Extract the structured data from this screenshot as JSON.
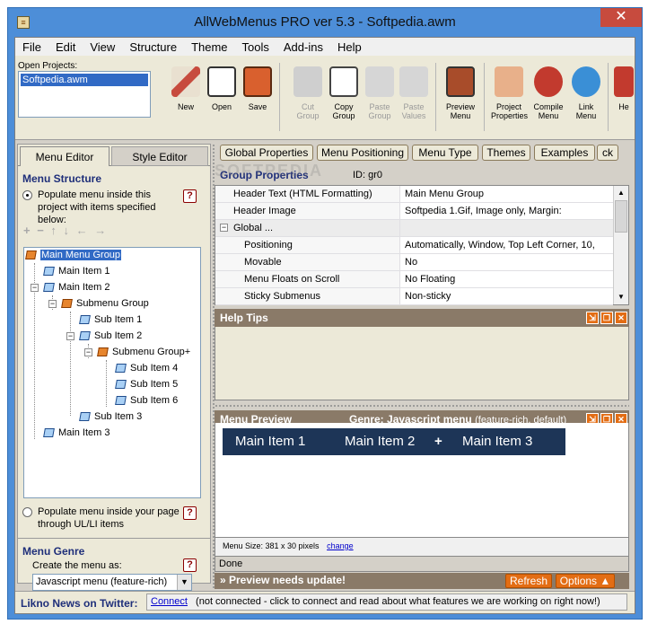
{
  "window": {
    "title": "AllWebMenus PRO ver 5.3 - Softpedia.awm",
    "close_glyph": "✕"
  },
  "menubar": [
    "File",
    "Edit",
    "View",
    "Structure",
    "Theme",
    "Tools",
    "Add-ins",
    "Help"
  ],
  "toolbar": {
    "open_projects_label": "Open Projects:",
    "open_projects": [
      "Softpedia.awm"
    ],
    "buttons": [
      {
        "label": "New",
        "icon": "new-icon",
        "enabled": true
      },
      {
        "label": "Open",
        "icon": "open-icon",
        "enabled": true
      },
      {
        "label": "Save",
        "icon": "save-icon",
        "enabled": true
      },
      {
        "label": "Cut Group",
        "icon": "cut-icon",
        "enabled": false
      },
      {
        "label": "Copy Group",
        "icon": "copy-icon",
        "enabled": true
      },
      {
        "label": "Paste Group",
        "icon": "paste-group-icon",
        "enabled": false
      },
      {
        "label": "Paste Values",
        "icon": "paste-values-icon",
        "enabled": false
      },
      {
        "label": "Preview Menu",
        "icon": "preview-icon",
        "enabled": true
      },
      {
        "label": "Project Properties",
        "icon": "properties-icon",
        "enabled": true
      },
      {
        "label": "Compile Menu",
        "icon": "compile-icon",
        "enabled": true
      },
      {
        "label": "Link Menu",
        "icon": "link-icon",
        "enabled": true
      },
      {
        "label": "He",
        "icon": "help-icon",
        "enabled": true
      }
    ]
  },
  "left_panel": {
    "tabs": [
      "Menu Editor",
      "Style Editor"
    ],
    "menu_structure_title": "Menu Structure",
    "populate_option_1": "Populate menu inside this project with items specified below:",
    "populate_option_2": "Populate menu inside your page through UL/LI items",
    "help_glyph": "?",
    "edit_toolbar_glyphs": "+ −   ↑ ↓ ← →",
    "tree": [
      {
        "label": "Main Menu Group",
        "level": 0,
        "group": true,
        "selected": true
      },
      {
        "label": "Main Item 1",
        "level": 1,
        "group": false
      },
      {
        "label": "Main Item 2",
        "level": 1,
        "group": false,
        "expander": "−"
      },
      {
        "label": "Submenu Group",
        "level": 2,
        "group": true,
        "expander": "−"
      },
      {
        "label": "Sub Item 1",
        "level": 3,
        "group": false
      },
      {
        "label": "Sub Item 2",
        "level": 3,
        "group": false,
        "expander": "−"
      },
      {
        "label": "Submenu Group+",
        "level": 4,
        "group": true,
        "expander": "−"
      },
      {
        "label": "Sub Item 4",
        "level": 5,
        "group": false
      },
      {
        "label": "Sub Item 5",
        "level": 5,
        "group": false
      },
      {
        "label": "Sub Item 6",
        "level": 5,
        "group": false
      },
      {
        "label": "Sub Item 3",
        "level": 3,
        "group": false
      },
      {
        "label": "Main Item 3",
        "level": 1,
        "group": false
      }
    ],
    "menu_genre_title": "Menu Genre",
    "create_label": "Create the menu as:",
    "genre_value": "Javascript menu (feature-rich)",
    "dropdown_glyph": "▼"
  },
  "right_panel": {
    "buttons": [
      "Global Properties",
      "Menu Positioning",
      "Menu Type",
      "Themes",
      "Examples",
      "ck"
    ],
    "group_properties_label": "Group Properties",
    "group_id": "ID: gr0",
    "properties": [
      {
        "name": "Header Text (HTML Formatting)",
        "value": "Main Menu Group",
        "indent": 1
      },
      {
        "name": "Header Image",
        "value": "Softpedia 1.Gif, Image only, Margin:",
        "indent": 1
      },
      {
        "name": "Global ...",
        "value": "",
        "indent": 0,
        "expander": "−"
      },
      {
        "name": "Positioning",
        "value": "Automatically, Window, Top Left Corner, 10,",
        "indent": 2
      },
      {
        "name": "Movable",
        "value": "No",
        "indent": 2
      },
      {
        "name": "Menu Floats on Scroll",
        "value": "No Floating",
        "indent": 2
      },
      {
        "name": "Sticky Submenus",
        "value": "Non-sticky",
        "indent": 2
      }
    ],
    "help_tips_title": "Help Tips",
    "preview_title": "Menu Preview",
    "genre_prefix": "Genre:",
    "genre_link": "Javascript menu",
    "genre_suffix": "(feature-rich, default)",
    "preview_items": [
      "Main Item 1",
      "Main Item 2",
      "Main Item 3"
    ],
    "preview_plus_glyph": "+",
    "menu_size_label": "Menu Size: 381 x 30 pixels",
    "change_link": "change",
    "done_text": "Done",
    "update_text": "» Preview needs update!",
    "refresh_label": "Refresh",
    "options_label": "Options ▲",
    "panel_button_glyphs": [
      "⇲",
      "❐",
      "✕"
    ]
  },
  "statusbar": {
    "label": "Likno News on Twitter:",
    "connect": "Connect",
    "message": "(not connected - click to connect and read about what features we are working on right now!)"
  },
  "watermark": "SOFTPEDIA"
}
